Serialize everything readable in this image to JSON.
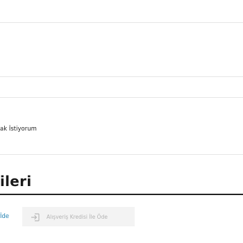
{
  "form": {
    "checkbox_label": "ak İstiyorum"
  },
  "payment_section": {
    "title": "ileri",
    "tabs": [
      {
        "label": "İde",
        "active": true
      },
      {
        "label": "Alışveriş Kredisi İle Öde",
        "active": false,
        "icon": "sign-in-arrow-icon"
      }
    ]
  },
  "colors": {
    "active_tab": "#1f7fb0",
    "inactive_tab_bg": "#f3f3f3",
    "inactive_tab_text": "#b3b3b3",
    "divider": "#e6e6e6"
  }
}
